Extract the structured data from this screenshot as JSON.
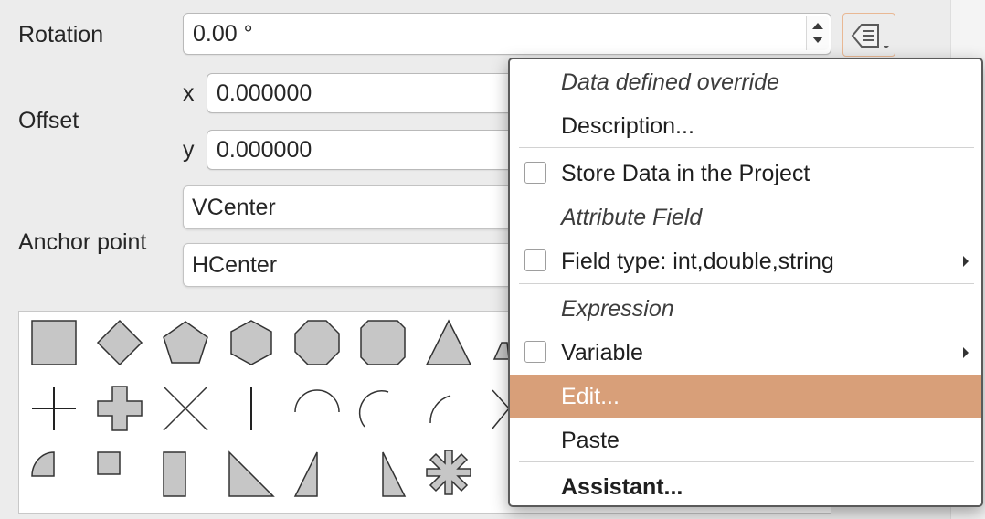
{
  "form": {
    "rotation_label": "Rotation",
    "rotation_value": "0.00 °",
    "offset_label": "Offset",
    "x_label": "x",
    "x_value": "0.000000",
    "y_label": "y",
    "y_value": "0.000000",
    "anchor_label": "Anchor point",
    "vanchor_value": "VCenter",
    "hanchor_value": "HCenter"
  },
  "icons": {
    "data_defined_button": "data-defined-override-icon",
    "spinner": "stepper-arrows-icon",
    "submenu": "chevron-right-icon"
  },
  "symbols": [
    "square",
    "diamond",
    "pentagon",
    "hexagon",
    "octagon",
    "decagon",
    "triangle",
    "cross",
    "cross-fill",
    "x",
    "line",
    "half-arc",
    "third-arc",
    "quarter-arc",
    "quarter-circle",
    "small-square",
    "rectangle",
    "right-half-triangle",
    "left-half-triangle",
    "right-triangle",
    "asterisk-fill"
  ],
  "menu": {
    "title": "Data defined override",
    "description": "Description...",
    "store_data": "Store Data in the Project",
    "attribute_section": "Attribute Field",
    "field_type": "Field type: int,double,string",
    "expression_section": "Expression",
    "variable": "Variable",
    "edit": "Edit...",
    "paste": "Paste",
    "assistant": "Assistant..."
  },
  "colors": {
    "highlight": "#d89f79",
    "button_border": "#e9b894",
    "symbol_fill": "#c6c6c6"
  }
}
